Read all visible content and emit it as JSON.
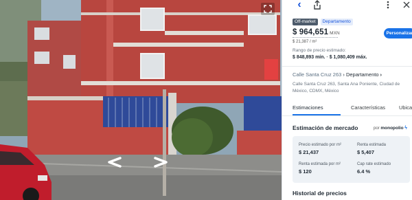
{
  "street_view": {
    "expand_icon": "expand-icon",
    "left_arrow_icon": "chevron-left-icon",
    "right_arrow_icon": "chevron-right-icon"
  },
  "topbar": {
    "back_icon": "chevron-left-icon",
    "share_icon": "share-icon",
    "more_icon": "more-vertical-icon",
    "close_icon": "close-icon"
  },
  "listing": {
    "badges": [
      "Off-market",
      "Departamento"
    ],
    "price": "$ 964,651",
    "currency": "MXN",
    "price_per_m2": "$ 21,387 / m²",
    "personalize_label": "Personalizar",
    "range_label": "Rango de precio estimado:",
    "range_min": "$ 848,893 mín.",
    "range_sep": " - ",
    "range_max": "$ 1,080,409 máx.",
    "street": "Calle Santa Cruz 263",
    "street_sep": " › ",
    "category": "Departamento",
    "address": "Calle Santa Cruz 263, Santa Ana Poniente, Ciudad de México, CDMX, México"
  },
  "tabs": [
    {
      "label": "Estimaciones",
      "active": true
    },
    {
      "label": "Características",
      "active": false
    },
    {
      "label": "Ubicac",
      "active": false
    }
  ],
  "market": {
    "title": "Estimación de mercado",
    "by_label": "por",
    "provider": "monopolio",
    "stats": [
      {
        "label": "Precio estimado por m²",
        "value": "$ 21,437"
      },
      {
        "label": "Renta estimada",
        "value": "$ 5,407"
      },
      {
        "label": "Renta estimada por m²",
        "value": "$ 120"
      },
      {
        "label": "Cap rate estimado",
        "value": "6.4 %"
      }
    ]
  },
  "history_title": "Historial de precios",
  "colors": {
    "accent": "#1a73e8",
    "building_red": "#b8463f",
    "gate_blue": "#2f4a99"
  }
}
